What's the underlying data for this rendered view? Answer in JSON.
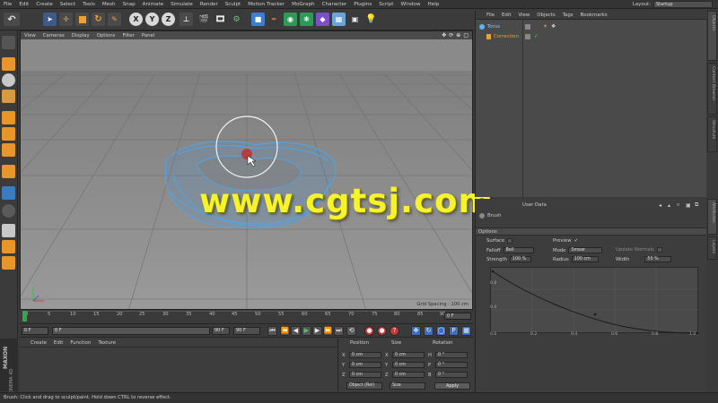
{
  "menubar": {
    "items": [
      "File",
      "Edit",
      "Create",
      "Select",
      "Tools",
      "Mesh",
      "Snap",
      "Animate",
      "Simulate",
      "Render",
      "Sculpt",
      "Motion Tracker",
      "MoGraph",
      "Character",
      "Plugins",
      "Script",
      "Window",
      "Help"
    ],
    "layout_label": "Layout:",
    "layout_value": "Startup"
  },
  "toolbar": {
    "axis_x": "X",
    "axis_y": "Y",
    "axis_z": "Z",
    "undo_icon": "undo-icon"
  },
  "viewport": {
    "menu": [
      "View",
      "Cameras",
      "Display",
      "Options",
      "Filter",
      "Panel"
    ],
    "grid_spacing": "Grid Spacing : 100 cm",
    "nav_icons": [
      "move-view-icon",
      "rotate-view-icon",
      "zoom-view-icon",
      "maximize-view-icon"
    ]
  },
  "watermark": "www.cgtsj.com",
  "timeline": {
    "ticks": [
      "0",
      "5",
      "10",
      "15",
      "20",
      "25",
      "30",
      "35",
      "40",
      "45",
      "50",
      "55",
      "60",
      "65",
      "70",
      "75",
      "80",
      "85",
      "90"
    ],
    "current_frame": "0 F"
  },
  "playbar": {
    "start_field": "0 F",
    "scroll_field": "0 F",
    "end_field_a": "90 F",
    "end_field_b": "90 F"
  },
  "material_panel": {
    "menu": [
      "Create",
      "Edit",
      "Function",
      "Texture"
    ]
  },
  "maxon": {
    "brand": "MAXON",
    "product": "CINEMA 4D"
  },
  "coordinates": {
    "headers": [
      "Position",
      "Size",
      "Rotation"
    ],
    "rows": [
      {
        "axis": "X",
        "pos": "0 cm",
        "size_axis": "X",
        "size": "0 cm",
        "rot_axis": "H",
        "rot": "0 °"
      },
      {
        "axis": "Y",
        "pos": "0 cm",
        "size_axis": "Y",
        "size": "0 cm",
        "rot_axis": "P",
        "rot": "0 °"
      },
      {
        "axis": "Z",
        "pos": "0 cm",
        "size_axis": "Z",
        "size": "0 cm",
        "rot_axis": "B",
        "rot": "0 °"
      }
    ],
    "mode_select": "Object (Rel)",
    "size_select": "Size",
    "apply_label": "Apply"
  },
  "status": "Brush: Click and drag to sculpt/paint. Hold down CTRL to reverse effect.",
  "object_manager": {
    "menu": [
      "File",
      "Edit",
      "View",
      "Objects",
      "Tags",
      "Bookmarks"
    ],
    "objects": [
      {
        "name": "Torus",
        "color": "#58b6f0"
      },
      {
        "name": "Correction",
        "color": "#e8a23a"
      }
    ],
    "side_tabs": [
      "Objects",
      "Content Browser",
      "Structure"
    ]
  },
  "attribute_manager": {
    "mode_label": "User Data",
    "tab_label": "Brush",
    "section": "Options",
    "surface_label": "Surface",
    "preview_label": "Preview",
    "preview_check": "✓",
    "falloff_label": "Falloff",
    "falloff_value": "Bell",
    "mode_label2": "Mode",
    "mode_value": "Smear",
    "update_normals_label": "Update Normals",
    "strength_label": "Strength",
    "strength_value": "100 %",
    "radius_label": "Radius",
    "radius_value": "100 cm",
    "width_label": "Width",
    "width_value": "50 %",
    "graph_y_labels": [
      "0.8",
      "0.4"
    ],
    "graph_x_labels": [
      "0.0",
      "0.2",
      "0.4",
      "0.6",
      "0.8",
      "1.0"
    ],
    "side_tabs": [
      "Attributes",
      "Layers"
    ]
  },
  "colors": {
    "accent_cube": "#e8962a",
    "play_green": "#2fa84a",
    "mesh_blue": "#4fa6e8",
    "watermark_yellow": "#f7f32a"
  }
}
